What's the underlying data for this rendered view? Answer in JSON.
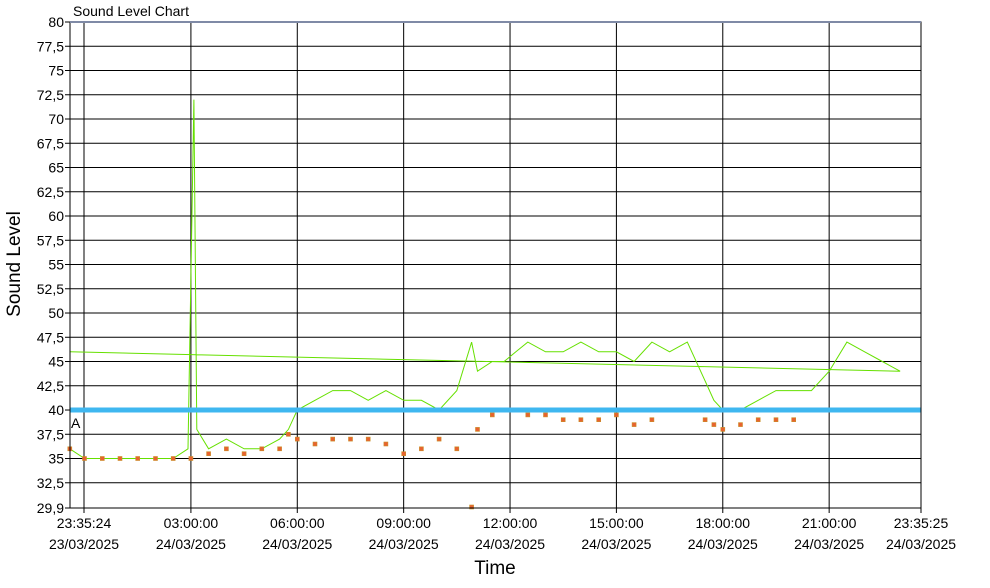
{
  "chart_data": {
    "type": "line",
    "title": "Sound Level Chart",
    "xlabel": "Time",
    "ylabel": "Sound Level",
    "ylim": [
      29.9,
      80
    ],
    "xlim": [
      "2025-03-23 23:35:24",
      "2025-03-24 23:35:25"
    ],
    "yticks": [
      "29,9",
      "32,5",
      "35",
      "37,5",
      "40",
      "42,5",
      "45",
      "47,5",
      "50",
      "52,5",
      "55",
      "57,5",
      "60",
      "62,5",
      "65",
      "67,5",
      "70",
      "72,5",
      "75",
      "77,5",
      "80"
    ],
    "xticks": [
      {
        "time": "23:35:24",
        "date": "23/03/2025"
      },
      {
        "time": "03:00:00",
        "date": "24/03/2025"
      },
      {
        "time": "06:00:00",
        "date": "24/03/2025"
      },
      {
        "time": "09:00:00",
        "date": "24/03/2025"
      },
      {
        "time": "12:00:00",
        "date": "24/03/2025"
      },
      {
        "time": "15:00:00",
        "date": "24/03/2025"
      },
      {
        "time": "18:00:00",
        "date": "24/03/2025"
      },
      {
        "time": "21:00:00",
        "date": "24/03/2025"
      },
      {
        "time": "23:35:25",
        "date": "24/03/2025"
      }
    ],
    "grid": true,
    "threshold": {
      "value": 40,
      "label": "A",
      "color": "#3fb7f0"
    },
    "colors": {
      "line": "#66e000",
      "marker_fill": "#e8622f",
      "marker_edge": "#c8902a"
    },
    "series": [
      {
        "x": [
          "23:35",
          "00:00",
          "00:30",
          "01:00",
          "01:30",
          "02:00",
          "02:30",
          "02:55",
          "03:05",
          "03:10",
          "03:30",
          "04:00",
          "04:30",
          "05:00",
          "05:30",
          "05:45",
          "06:00",
          "06:30",
          "07:00",
          "07:30",
          "08:00",
          "08:30",
          "09:00",
          "09:30",
          "10:00",
          "10:30",
          "10:55",
          "11:05",
          "11:30",
          "11:50",
          "12:10",
          "12:30",
          "13:00",
          "13:30",
          "14:00",
          "14:30",
          "15:00",
          "15:30",
          "16:00",
          "16:30",
          "17:00",
          "17:30",
          "17:45",
          "18:00",
          "18:30",
          "19:00",
          "19:30",
          "20:00",
          "20:30",
          "21:00",
          "21:30",
          "22:00",
          "22:30",
          "23:00",
          "23:35"
        ],
        "y": [
          36,
          35,
          35,
          35,
          35,
          35,
          35,
          36,
          72,
          38,
          36,
          37,
          36,
          36,
          37,
          38,
          40,
          41,
          42,
          42,
          41,
          42,
          41,
          41,
          40,
          42,
          47,
          44,
          45,
          45,
          46,
          47,
          46,
          46,
          47,
          46,
          46,
          45,
          47,
          46,
          47,
          43,
          41,
          40,
          40,
          41,
          42,
          42,
          42,
          44,
          47,
          46,
          45,
          44,
          46
        ]
      },
      {
        "x": [
          "23:35",
          "00:00",
          "00:30",
          "01:00",
          "01:30",
          "02:00",
          "02:30",
          "03:00",
          "03:30",
          "04:00",
          "04:30",
          "05:00",
          "05:30",
          "05:45",
          "06:00",
          "06:30",
          "07:00",
          "07:30",
          "08:00",
          "08:30",
          "09:00",
          "09:30",
          "10:00",
          "10:30",
          "10:55",
          "11:05",
          "11:30",
          "12:00",
          "12:30",
          "13:00",
          "13:30",
          "14:00",
          "14:30",
          "15:00",
          "15:30",
          "16:00",
          "17:30",
          "17:45",
          "18:00",
          "18:30",
          "19:00",
          "19:30",
          "20:00"
        ],
        "y": [
          36,
          35,
          35,
          35,
          35,
          35,
          35,
          35,
          35.5,
          36,
          35.5,
          36,
          36,
          37.5,
          37,
          36.5,
          37,
          37,
          37,
          36.5,
          35.5,
          36,
          37,
          36,
          30,
          38,
          39.5,
          40,
          39.5,
          39.5,
          39,
          39,
          39,
          39.5,
          38.5,
          39,
          39,
          38.5,
          38,
          38.5,
          39,
          39,
          39
        ]
      }
    ]
  }
}
